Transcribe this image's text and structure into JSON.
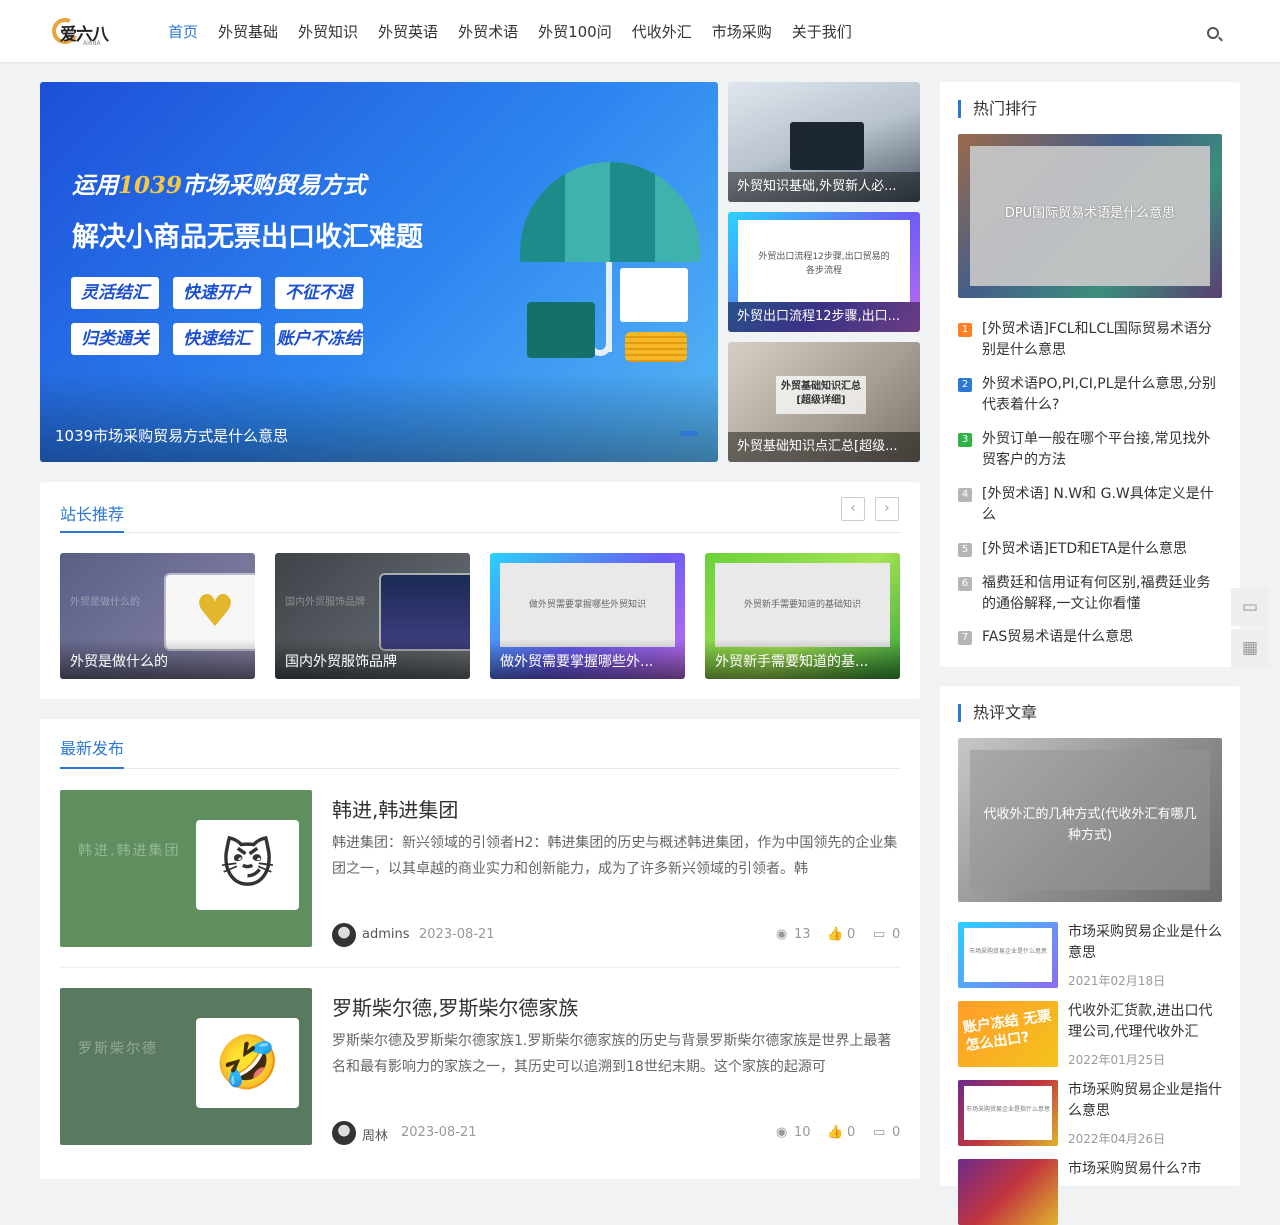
{
  "logo": {
    "text": "爱六八",
    "sub": "AI68A"
  },
  "nav": [
    "首页",
    "外贸基础",
    "外贸知识",
    "外贸英语",
    "外贸术语",
    "外贸100问",
    "代收外汇",
    "市场采购",
    "关于我们"
  ],
  "slider": {
    "line1_pre": "运用",
    "line1_hl": "1039",
    "line1_post": "市场采购贸易方式",
    "line2": "解决小商品无票出口收汇难题",
    "tags": [
      "灵活结汇",
      "快速开户",
      "不征不退",
      "归类通关",
      "快速结汇",
      "账户不冻结"
    ],
    "caption": "1039市场采购贸易方式是什么意思"
  },
  "thumbs": [
    {
      "caption": "外贸知识基础,外贸新人必..."
    },
    {
      "caption": "外贸出口流程12步骤,出口...",
      "inner": "外贸出口流程12步骤,出口贸易的各步流程"
    },
    {
      "caption": "外贸基础知识点汇总[超级...",
      "inner": "外贸基础知识汇总 [超级详细]"
    }
  ],
  "recommend": {
    "title": "站长推荐",
    "prev": "‹",
    "next": "›",
    "items": [
      {
        "caption": "外贸是做什么的",
        "ghost": "外贸是做什么的"
      },
      {
        "caption": "国内外贸服饰品牌",
        "ghost": "国内外贸服饰品牌"
      },
      {
        "caption": "做外贸需要掌握哪些外...",
        "ghost": "做外贸需要掌握哪些外贸知识"
      },
      {
        "caption": "外贸新手需要知道的基...",
        "ghost": "外贸新手需要知道的基础知识"
      }
    ]
  },
  "latest": {
    "title": "最新发布",
    "posts": [
      {
        "title": "韩进,韩进集团",
        "excerpt": "韩进集团：新兴领域的引领者H2：韩进集团的历史与概述韩进集团，作为中国领先的企业集团之一，以其卓越的商业实力和创新能力，成为了许多新兴领域的引领者。韩",
        "author": "admins",
        "date": "2023-08-21",
        "views": "13",
        "likes": "0",
        "comments": "0",
        "ghost": "韩进,韩进集团",
        "emoji": "😼"
      },
      {
        "title": "罗斯柴尔德,罗斯柴尔德家族",
        "excerpt": "罗斯柴尔德及罗斯柴尔德家族1.罗斯柴尔德家族的历史与背景罗斯柴尔德家族是世界上最著名和最有影响力的家族之一，其历史可以追溯到18世纪末期。这个家族的起源可",
        "author": "周林",
        "date": "2023-08-21",
        "views": "10",
        "likes": "0",
        "comments": "0",
        "ghost": "罗斯柴尔德",
        "emoji": "🤣"
      }
    ]
  },
  "hot_rank": {
    "title": "热门排行",
    "feature": "DPU国际贸易术语是什么意思",
    "items": [
      "[外贸术语]FCL和LCL国际贸易术语分别是什么意思",
      "外贸术语PO,PI,CI,PL是什么意思,分别代表着什么?",
      "外贸订单一般在哪个平台接,常见找外贸客户的方法",
      "[外贸术语] N.W和 G.W具体定义是什么",
      "[外贸术语]ETD和ETA是什么意思",
      "福费廷和信用证有何区别,福费廷业务的通俗解释,一文让你看懂",
      "FAS贸易术语是什么意思"
    ],
    "nums": [
      "1",
      "2",
      "3",
      "4",
      "5",
      "6",
      "7"
    ]
  },
  "hot_comment": {
    "title": "热评文章",
    "feature": "代收外汇的几种方式(代收外汇有哪几种方式)",
    "items": [
      {
        "title": "市场采购贸易企业是什么意思",
        "date": "2021年02月18日",
        "inner": "市场采购贸易企业是什么意思"
      },
      {
        "title": "代收外汇货款,进出口代理公司,代理代收外汇",
        "date": "2022年01月25日",
        "inner": "账户冻结 无票怎么出口?"
      },
      {
        "title": "市场采购贸易企业是指什么意思",
        "date": "2022年04月26日",
        "inner": "市场采购贸易企业是指什么意思"
      },
      {
        "title": "市场采购贸易什么?市",
        "date": "",
        "inner": ""
      }
    ]
  },
  "float": {
    "chat": "▭",
    "qr": "▦"
  },
  "colors": {
    "accent": "#2c78d4",
    "rank1": "#ff7f24",
    "rank2": "#2c78d4",
    "rank3": "#2fb344",
    "rank_other": "#b5b5b5"
  }
}
